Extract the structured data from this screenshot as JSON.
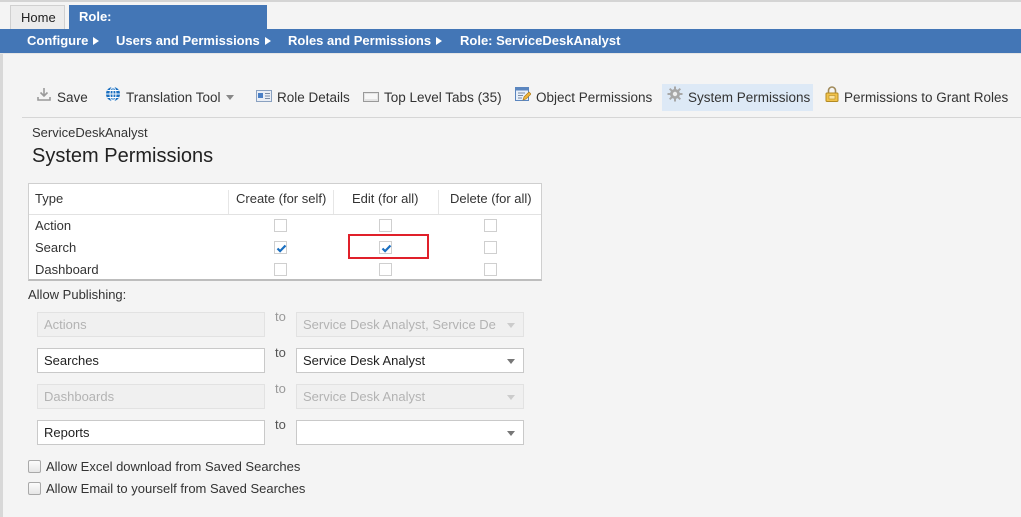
{
  "tabs": [
    {
      "label": "Home",
      "active": false
    },
    {
      "label": "Role: ServiceDeskAnalyst",
      "active": true,
      "closable": true
    }
  ],
  "breadcrumb": [
    "Configure",
    "Users and Permissions",
    "Roles and Permissions",
    "Role: ServiceDeskAnalyst"
  ],
  "toolbar": {
    "items": [
      {
        "label": "Save",
        "icon": "download-icon"
      },
      {
        "label": "Translation Tool",
        "icon": "globe-icon",
        "dropdown": true
      },
      {
        "label": "Role Details",
        "icon": "id-card-icon"
      },
      {
        "label": "Top Level Tabs (35)",
        "icon": "tab-icon"
      },
      {
        "label": "Object Permissions",
        "icon": "edit-form-icon"
      },
      {
        "label": "System Permissions",
        "icon": "gear-icon",
        "selected": true
      },
      {
        "label": "Permissions to Grant Roles",
        "icon": "lock-icon"
      }
    ]
  },
  "page": {
    "subtitle": "ServiceDeskAnalyst",
    "title": "System Permissions"
  },
  "permissions_table": {
    "columns": [
      "Type",
      "Create (for self)",
      "Edit (for all)",
      "Delete (for all)"
    ],
    "rows": [
      {
        "type": "Action",
        "create": false,
        "edit": false,
        "delete": false
      },
      {
        "type": "Search",
        "create": true,
        "edit": true,
        "delete": false
      },
      {
        "type": "Dashboard",
        "create": false,
        "edit": false,
        "delete": false
      }
    ],
    "highlighted_cell": "Search / Edit (for all)",
    "check_color": "#1a6fc0",
    "highlight_color": "#e0202a"
  },
  "publishing": {
    "label": "Allow Publishing:",
    "to_label": "to",
    "rows": [
      {
        "name": "Actions",
        "target": "Service Desk Analyst, Service De",
        "disabled": true
      },
      {
        "name": "Searches",
        "target": "Service Desk Analyst",
        "disabled": false
      },
      {
        "name": "Dashboards",
        "target": "Service Desk Analyst",
        "disabled": true
      },
      {
        "name": "Reports",
        "target": "",
        "disabled": false
      }
    ]
  },
  "options": [
    {
      "label": "Allow Excel download from Saved Searches",
      "checked": false
    },
    {
      "label": "Allow Email to yourself from Saved Searches",
      "checked": false
    }
  ],
  "colors": {
    "brand_blue": "#4376b6",
    "background": "#f4f4f4",
    "selected_tab_bg": "#dde9f6"
  }
}
